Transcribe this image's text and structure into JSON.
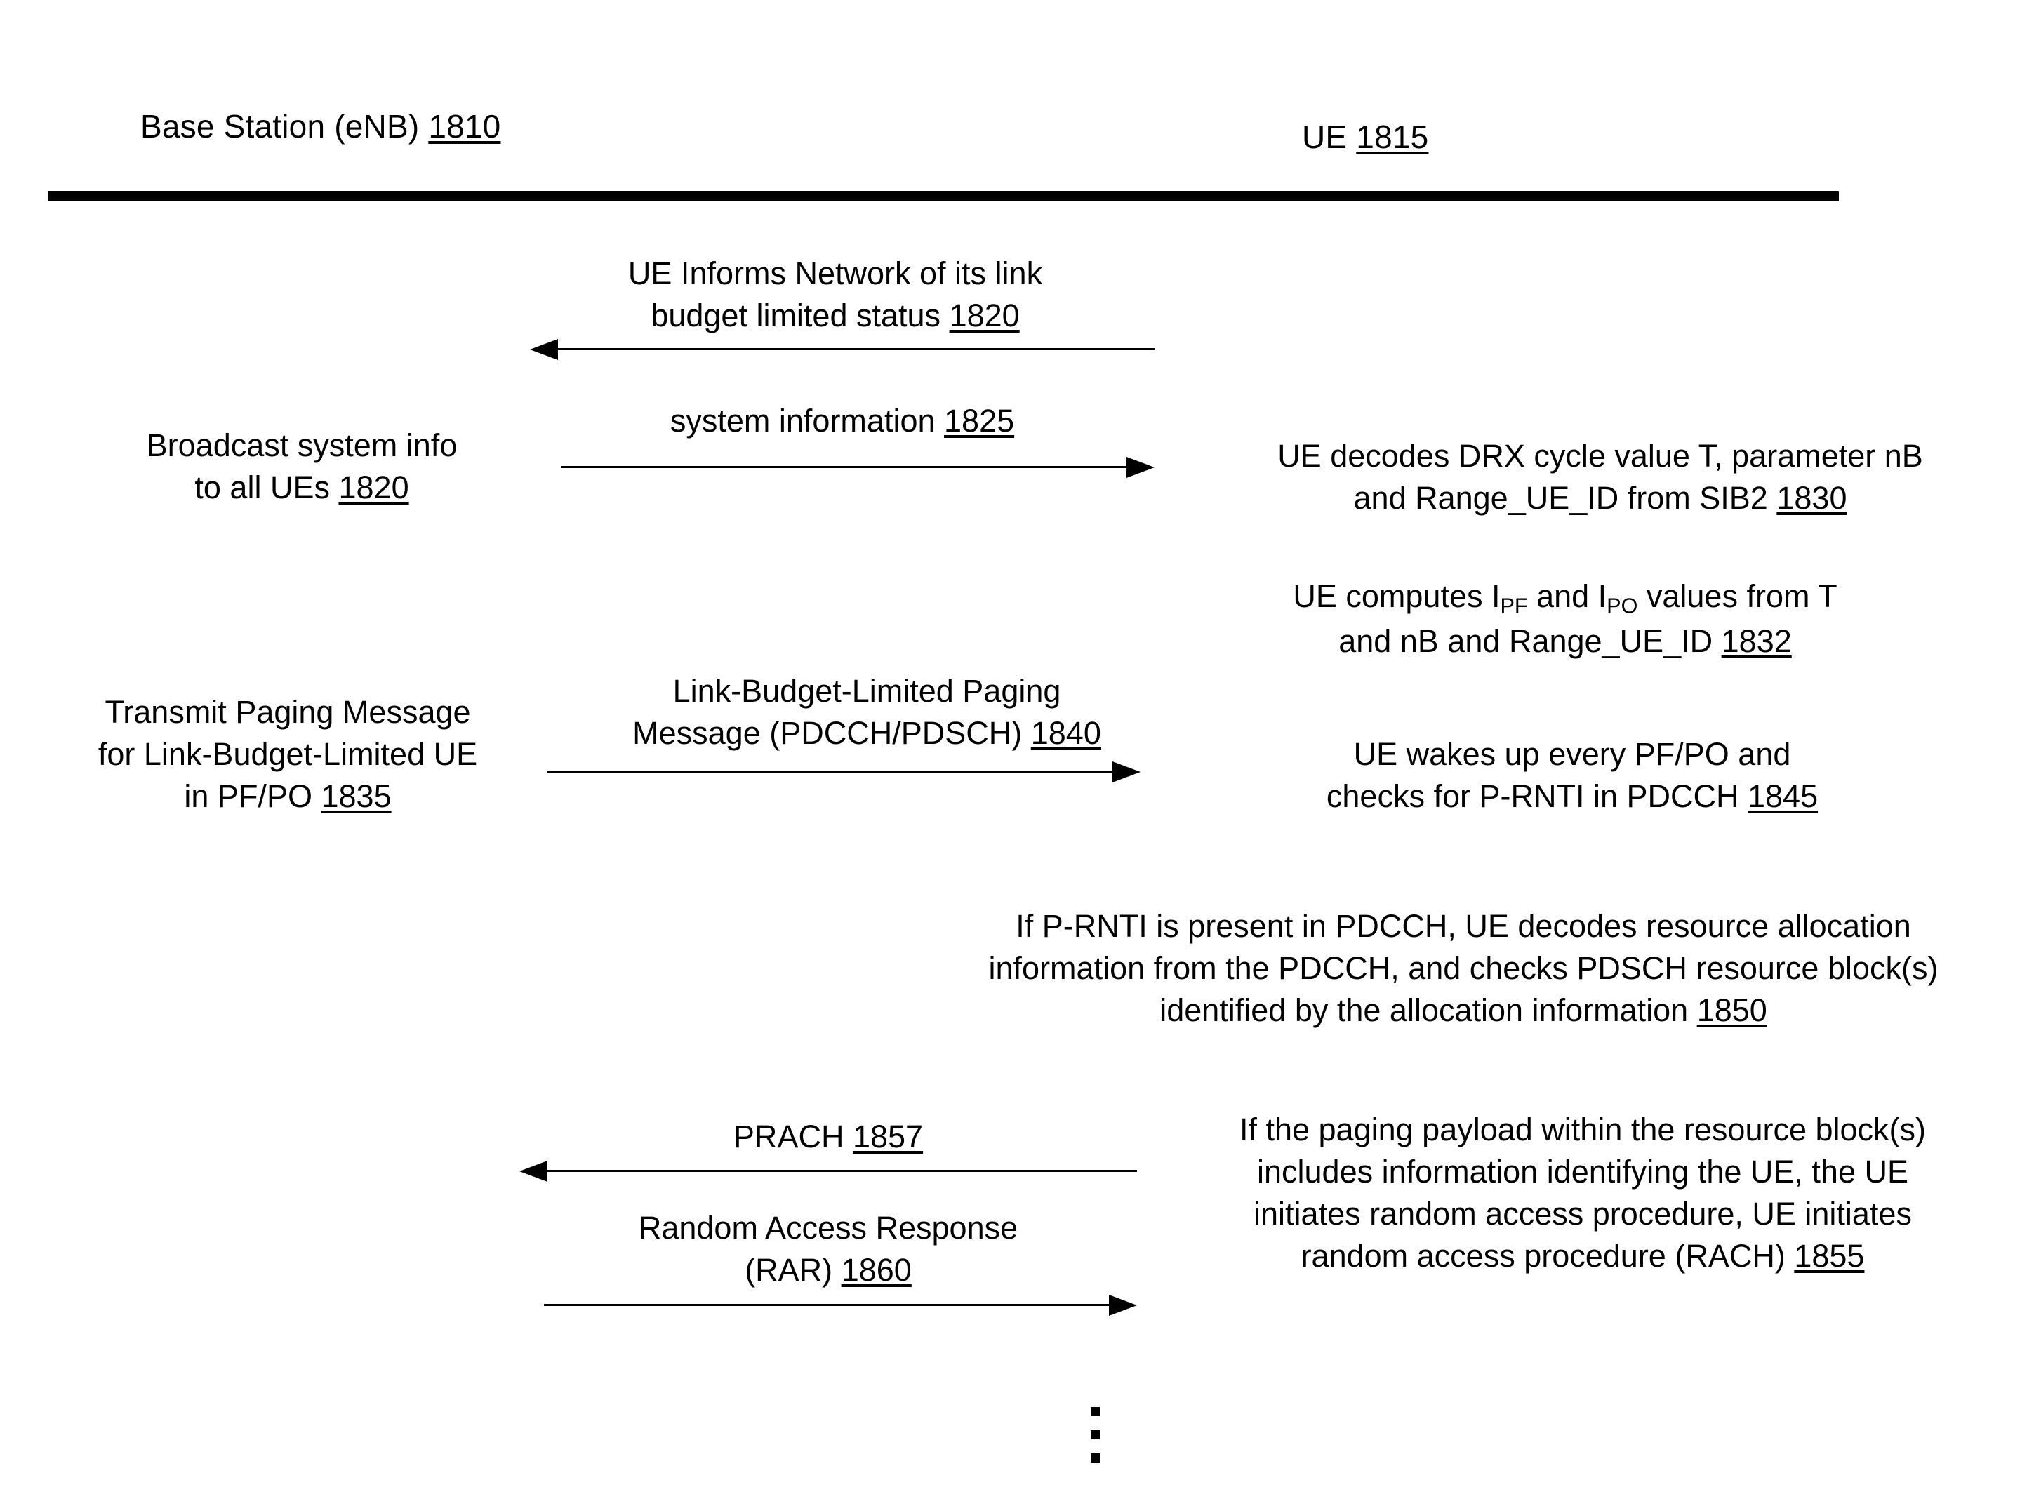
{
  "figure": {
    "actors": [
      {
        "name": "base-station",
        "label": "Base Station (eNB)",
        "ref": "1810"
      },
      {
        "name": "ue",
        "label": "UE",
        "ref": "1815"
      }
    ],
    "messages": [
      {
        "name": "ue-informs-network",
        "direction": "to-left",
        "label_line1": "UE Informs Network of its link",
        "label_line2": "budget limited status",
        "ref": "1820"
      },
      {
        "name": "system-information",
        "direction": "to-right",
        "label_line1": "system information",
        "label_line2": "",
        "ref": "1825"
      },
      {
        "name": "link-budget-limited-paging-message",
        "direction": "to-right",
        "label_line1": "Link-Budget-Limited Paging",
        "label_line2": "Message (PDCCH/PDSCH)",
        "ref": "1840"
      },
      {
        "name": "prach",
        "direction": "to-left",
        "label_line1": "PRACH",
        "label_line2": "",
        "ref": "1857"
      },
      {
        "name": "random-access-response",
        "direction": "to-right",
        "label_line1": "Random Access Response",
        "label_line2": "(RAR)",
        "ref": "1860"
      }
    ],
    "left_notes": [
      {
        "name": "broadcast-system-info",
        "text": "Broadcast system info\nto all UEs",
        "ref": "1820"
      },
      {
        "name": "transmit-paging-message",
        "text": "Transmit Paging Message\nfor Link-Budget-Limited UE\nin PF/PO",
        "ref": "1835"
      }
    ],
    "right_notes": [
      {
        "name": "ue-decodes-drx",
        "text": "UE decodes DRX cycle value T, parameter nB\nand Range_UE_ID from SIB2",
        "ref": "1830"
      },
      {
        "name": "ue-computes-ipf-ipo",
        "text_pre": "UE computes I",
        "sub1": "PF",
        "text_mid": " and I",
        "sub2": "PO",
        "text_post": " values from T",
        "text_line2": "and nB and Range_UE_ID",
        "ref": "1832"
      },
      {
        "name": "ue-wakes-up",
        "text": "UE wakes up every PF/PO and\nchecks for P-RNTI in PDCCH",
        "ref": "1845"
      },
      {
        "name": "p-rnti-present",
        "text": "If P-RNTI is present in PDCCH, UE decodes resource allocation\ninformation from the PDCCH, and checks PDSCH resource block(s)\nidentified by the allocation information",
        "ref": "1850"
      },
      {
        "name": "paging-payload-rach",
        "text": "If the paging payload within the resource block(s)\nincludes information identifying the UE, the UE\ninitiates random access procedure, UE initiates\nrandom access procedure (RACH)",
        "ref": "1855"
      }
    ],
    "continuation": {
      "name": "vertical-ellipsis",
      "glyph": "⋮"
    },
    "colors": {
      "ink": "#000000",
      "background": "#ffffff"
    }
  }
}
